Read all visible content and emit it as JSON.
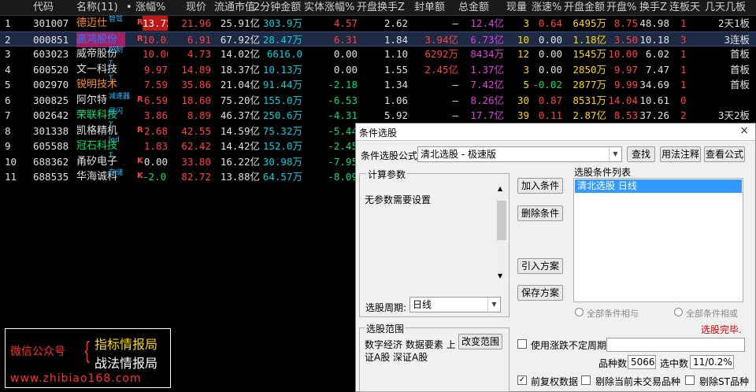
{
  "header": {
    "cols": [
      "代码",
      "名称(11)",
      "•",
      "涨幅%",
      "现价",
      "流通市值",
      "2分钟金额",
      "实体涨幅%",
      "开盘换手Z",
      "封单额",
      "总金额",
      "现量",
      "涨速%",
      "开盘金额",
      "开盘%",
      "换手Z",
      "连板天",
      "几天几板"
    ]
  },
  "rows": [
    {
      "idx": "1",
      "code": "301007",
      "name": "德迈仕",
      "tag": "智驾",
      "mark": "R",
      "chg": "13.72",
      "price": "21.96",
      "mcap": "25.91亿",
      "amt2m": "303.9万",
      "body": "4.57",
      "openturn": "2.62",
      "seal": "—",
      "total": "12.4亿",
      "vol": "3",
      "speed": "0.64",
      "openamt": "6495万",
      "openpct": "8.75",
      "turn": "48.98",
      "lb": "1",
      "jtjb": "2天1板"
    },
    {
      "idx": "2",
      "code": "000851",
      "name": "高鸿股份",
      "tag": "",
      "mark": "R",
      "chg": "10.03",
      "price": "6.91",
      "mcap": "67.92亿",
      "amt2m": "28.47万",
      "body": "6.31",
      "openturn": "1.84",
      "seal": "3.94亿",
      "total": "6.73亿",
      "vol": "10",
      "speed": "0.00",
      "openamt": "1.18亿",
      "openpct": "3.50",
      "turn": "10.18",
      "lb": "3",
      "jtjb": "3连板"
    },
    {
      "idx": "3",
      "code": "603023",
      "name": "威帝股份",
      "tag": "控制",
      "mark": "",
      "chg": "10.00",
      "price": "4.73",
      "mcap": "14.02亿",
      "amt2m": "6616.0",
      "body": "0.00",
      "openturn": "1.10",
      "seal": "6292万",
      "total": "8434万",
      "vol": "12",
      "speed": "0.00",
      "openamt": "1545万",
      "openpct": "10.00",
      "turn": "6.02",
      "lb": "1",
      "jtjb": "首板"
    },
    {
      "idx": "4",
      "code": "600520",
      "name": "文一科技",
      "tag": "T",
      "mark": "",
      "chg": "9.97",
      "price": "14.89",
      "mcap": "18.37亿",
      "amt2m": "10.13万",
      "body": "0.00",
      "openturn": "1.55",
      "seal": "2.45亿",
      "total": "1.37亿",
      "vol": "3",
      "speed": "0.00",
      "openamt": "2850万",
      "openpct": "9.97",
      "turn": "7.47",
      "lb": "1",
      "jtjb": "首板"
    },
    {
      "idx": "5",
      "code": "002970",
      "name": "锐明技术",
      "tag": "T",
      "mark": "",
      "chg": "7.59",
      "price": "35.86",
      "mcap": "21.04亿",
      "amt2m": "91.44万",
      "body": "-2.18",
      "openturn": "1.34",
      "seal": "—",
      "total": "7.42亿",
      "vol": "5",
      "speed": "-0.02",
      "openamt": "2877万",
      "openpct": "9.99",
      "turn": "34.69",
      "lb": "1",
      "jtjb": "首板"
    },
    {
      "idx": "6",
      "code": "300825",
      "name": "阿尔特",
      "tag": "减速器",
      "mark": "R",
      "chg": "6.59",
      "price": "18.60",
      "mcap": "75.20亿",
      "amt2m": "155.0万",
      "body": "-6.53",
      "openturn": "1.06",
      "seal": "—",
      "total": "8.26亿",
      "vol": "30",
      "speed": "0.87",
      "openamt": "8531万",
      "openpct": "14.04",
      "turn": "10.61",
      "lb": "0",
      "jtjb": ""
    },
    {
      "idx": "7",
      "code": "002642",
      "name": "荣联科技",
      "tag": "星闪",
      "mark": "",
      "chg": "3.86",
      "price": "8.89",
      "mcap": "46.37亿",
      "amt2m": "250.6万",
      "body": "-4.31",
      "openturn": "5.92",
      "seal": "—",
      "total": "17.7亿",
      "vol": "39",
      "speed": "0.11",
      "openamt": "2.87亿",
      "openpct": "8.53",
      "turn": "37.26",
      "lb": "2",
      "jtjb": "3天2板"
    },
    {
      "idx": "8",
      "code": "301338",
      "name": "凯格精机",
      "tag": "T",
      "mark": "R",
      "chg": "2.68",
      "price": "42.55",
      "mcap": "14.59亿",
      "amt2m": "75.32万",
      "body": "-5.44",
      "openturn": "",
      "seal": "",
      "total": "",
      "vol": "",
      "speed": "",
      "openamt": "",
      "openpct": "",
      "turn": "",
      "lb": "",
      "jtjb": ""
    },
    {
      "idx": "9",
      "code": "605588",
      "name": "冠石科技",
      "tag": "led",
      "mark": "",
      "chg": "1.83",
      "price": "62.42",
      "mcap": "14.42亿",
      "amt2m": "152.0万",
      "body": "-2.45",
      "openturn": "",
      "seal": "",
      "total": "",
      "vol": "",
      "speed": "",
      "openamt": "",
      "openpct": "",
      "turn": "",
      "lb": "",
      "jtjb": ""
    },
    {
      "idx": "10",
      "code": "688362",
      "name": "甬矽电子",
      "tag": "T",
      "mark": "K",
      "chg": "0.00",
      "price": "33.80",
      "mcap": "16.22亿",
      "amt2m": "30.98万",
      "body": "-7.95",
      "openturn": "",
      "seal": "",
      "total": "",
      "vol": "",
      "speed": "",
      "openamt": "",
      "openpct": "",
      "turn": "",
      "lb": "",
      "jtjb": ""
    },
    {
      "idx": "11",
      "code": "688535",
      "name": "华海诚科",
      "tag": "存储",
      "mark": "K",
      "chg": "-2.01",
      "price": "82.72",
      "mcap": "13.88亿",
      "amt2m": "64.57万",
      "body": "-8.09",
      "openturn": "",
      "seal": "",
      "total": "",
      "vol": "",
      "speed": "",
      "openamt": "",
      "openpct": "",
      "turn": "",
      "lb": "",
      "jtjb": ""
    }
  ],
  "dialog": {
    "title": "条件选股",
    "close": "×",
    "formula_label": "条件选股公式",
    "formula_value": "清北选股 - 极速版",
    "find": "查找",
    "usage": "用法注释",
    "view_formula": "查看公式",
    "params_title": "计算参数",
    "params_text": "无参数需要设置",
    "add_cond": "加入条件",
    "del_cond": "删除条件",
    "import_plan": "引入方案",
    "save_plan": "保存方案",
    "list_title": "选股条件列表",
    "list_item": "清北选股 日线",
    "period_label": "选股周期:",
    "period_value": "日线",
    "radio_and": "全部条件相与",
    "radio_or": "全部条件相或",
    "done": "选股完毕.",
    "scope_title": "选股范围",
    "scope_text_1": "数字经济 数据要素 上",
    "scope_text_2": "证A股 深证A股",
    "change_scope": "改变范围",
    "use_cycle": "使用涨跌不定周期",
    "count_label": "品种数",
    "count_value": "5066",
    "selected_label": "选中数",
    "selected_value": "11/0.2%",
    "fuquan": "前复权数据",
    "exclude_nontrade": "剔除当前未交易品种",
    "exclude_st": "剔除ST品种"
  },
  "watermark": {
    "wechat": "微信公众号",
    "line1": "指标情报局",
    "line2": "战法情报局",
    "site": "www.zhibiao168.com"
  }
}
